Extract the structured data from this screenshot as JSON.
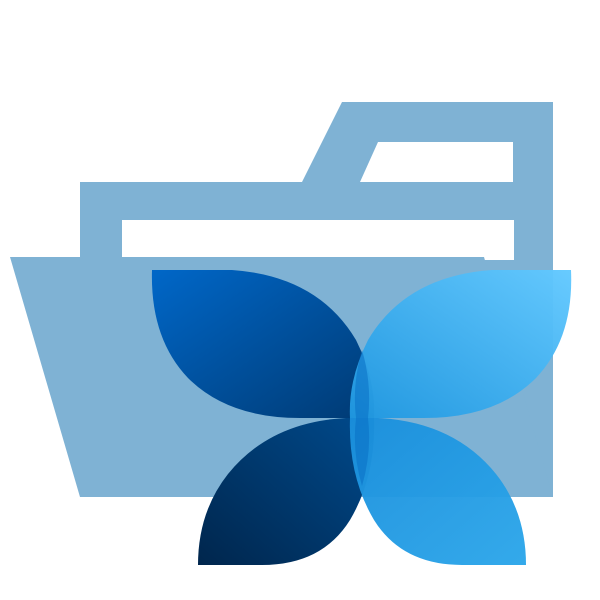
{
  "icon": {
    "name": "folder-with-butterfly-icon",
    "colors": {
      "folder": "#7fb2d4",
      "paper": "#ffffff",
      "butterfly_dark": "#003566",
      "butterfly_mid": "#0a64b8",
      "butterfly_light": "#1e9be4",
      "butterfly_highlight": "#60c6fd"
    }
  }
}
